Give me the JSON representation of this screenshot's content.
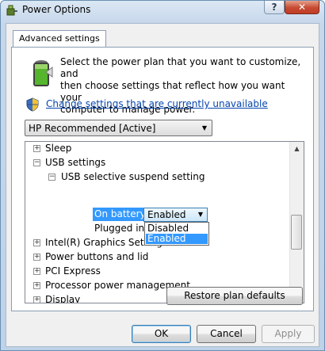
{
  "window": {
    "title": "Power Options",
    "help_symbol": "?",
    "close_symbol": "✕",
    "icon": "power-options-icon"
  },
  "tab": {
    "label": "Advanced settings"
  },
  "intro": {
    "lines": [
      "Select the power plan that you want to customize, and",
      "then choose settings that reflect how you want your",
      "computer to manage power."
    ]
  },
  "link": {
    "label": "Change settings that are currently unavailable"
  },
  "plan_select": {
    "value": "HP Recommended [Active]"
  },
  "tree": {
    "sleep": "Sleep",
    "usb": "USB settings",
    "usb_suspend": "USB selective suspend setting",
    "on_battery": "On battery:",
    "on_battery_value": "Enabled",
    "plugged_in": "Plugged in:",
    "graphics": "Intel(R) Graphics Settings",
    "power_buttons": "Power buttons and lid",
    "pci": "PCI Express",
    "processor": "Processor power management",
    "display": "Display",
    "expand_symbol": "+",
    "collapse_symbol": "−"
  },
  "dropdown": {
    "options": [
      "Disabled",
      "Enabled"
    ],
    "selected": "Enabled"
  },
  "buttons": {
    "restore": "Restore plan defaults",
    "ok": "OK",
    "cancel": "Cancel",
    "apply": "Apply"
  },
  "colors": {
    "selection": "#3399ff",
    "link": "#0645ad",
    "close": "#c64a32"
  }
}
